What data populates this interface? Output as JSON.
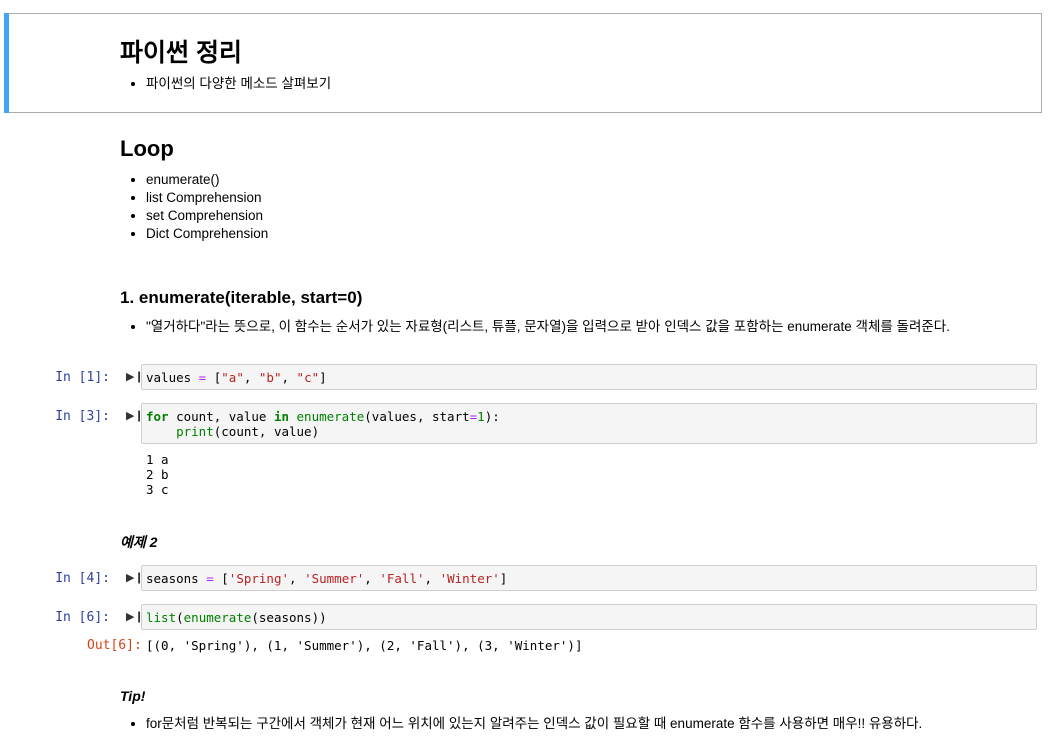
{
  "title_cell": {
    "heading": "파이썬 정리",
    "bullets": [
      "파이썬의 다양한 메소드 살펴보기"
    ]
  },
  "loop": {
    "heading": "Loop",
    "bullets": [
      "enumerate()",
      "list Comprehension",
      "set Comprehension",
      "Dict Comprehension"
    ]
  },
  "enumerate_section": {
    "heading": "1. enumerate(iterable, start=0)",
    "bullet": "\"열거하다\"라는 뜻으로, 이 함수는 순서가 있는 자료형(리스트, 튜플, 문자열)을 입력으로 받아 인덱스 값을 포함하는 enumerate 객체를 돌려준다."
  },
  "cells": {
    "c1": {
      "prompt": "In [1]:",
      "code": [
        "values",
        " = ",
        "[",
        "\"a\"",
        ", ",
        "\"b\"",
        ", ",
        "\"c\"",
        "]"
      ]
    },
    "c3": {
      "prompt": "In [3]:",
      "line1": [
        "for",
        " count, value ",
        "in",
        " ",
        "enumerate",
        "(values, start",
        "=",
        "1",
        "):"
      ],
      "line2": [
        "    ",
        "print",
        "(count, value)"
      ],
      "output": "1 a\n2 b\n3 c"
    },
    "example_label": "예제 2",
    "c4": {
      "prompt": "In [4]:",
      "code": [
        "seasons",
        " = ",
        "[",
        "'Spring'",
        ", ",
        "'Summer'",
        ", ",
        "'Fall'",
        ", ",
        "'Winter'",
        "]"
      ]
    },
    "c6": {
      "prompt": "In [6]:",
      "code": [
        "list",
        "(",
        "enumerate",
        "(seasons))"
      ],
      "out_prompt": "Out[6]:",
      "output": "[(0, 'Spring'), (1, 'Summer'), (2, 'Fall'), (3, 'Winter')]"
    }
  },
  "tip": {
    "label": "Tip!",
    "bullet": "for문처럼 반복되는 구간에서 객체가 현재 어느 위치에 있는지 알려주는 인덱스 값이 필요할 때 enumerate 함수를 사용하면 매우!! 유용하다."
  },
  "icons": {
    "run": "run-cell-icon"
  },
  "colors": {
    "selection_bar": "#42a5f5",
    "prompt_in": "#303f9f",
    "prompt_out": "#d84315"
  }
}
